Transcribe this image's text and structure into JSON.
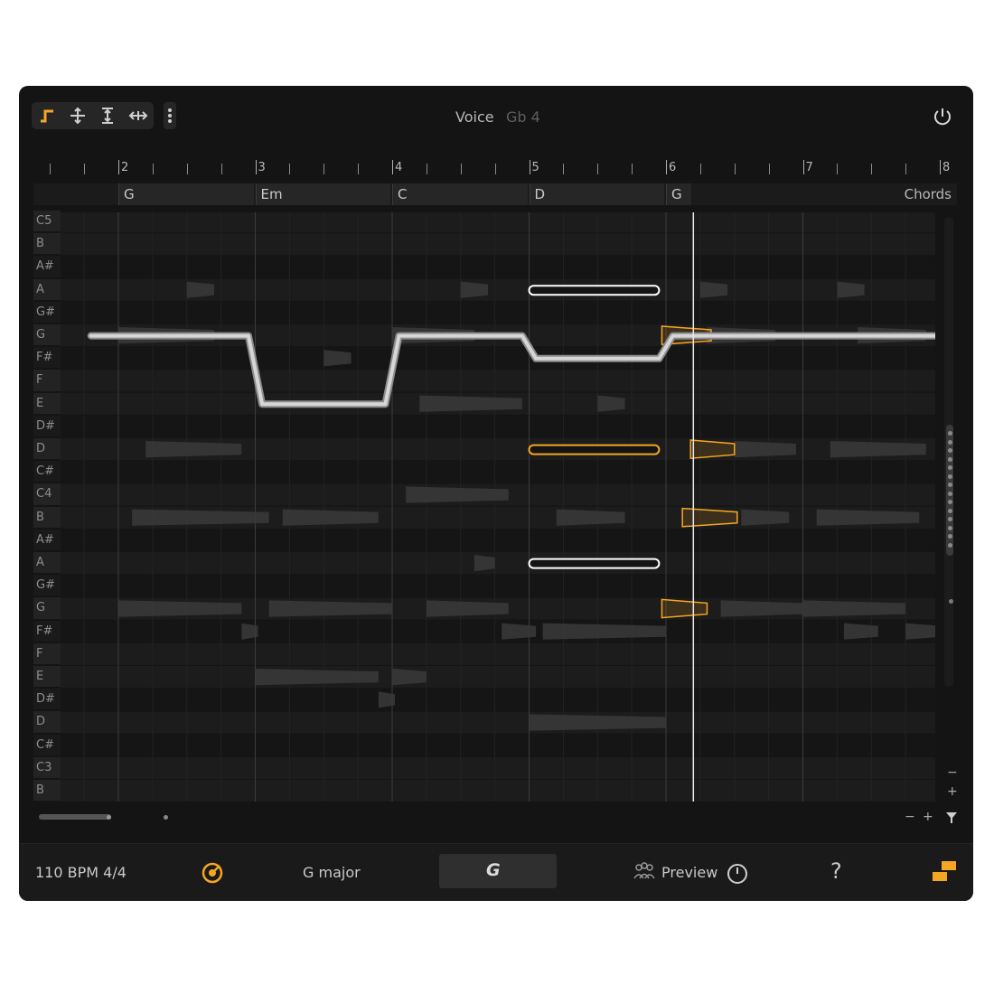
{
  "app": {
    "title_voice": "Voice",
    "title_pitch": "Gb 4"
  },
  "toolbar": {
    "tools": [
      {
        "name": "note-tool-icon",
        "active": true
      },
      {
        "name": "move-tool-icon",
        "active": false
      },
      {
        "name": "stretch-tool-icon",
        "active": false
      },
      {
        "name": "time-tool-icon",
        "active": false
      }
    ],
    "more_icon": "more-vertical-icon",
    "power_icon": "power-icon"
  },
  "ruler": {
    "bars": [
      "2",
      "3",
      "4",
      "5",
      "6",
      "7",
      "8"
    ]
  },
  "chords": {
    "items": [
      {
        "name": "G",
        "start": 2,
        "end": 3
      },
      {
        "name": "Em",
        "start": 3,
        "end": 4
      },
      {
        "name": "C",
        "start": 4,
        "end": 5
      },
      {
        "name": "D",
        "start": 5,
        "end": 6
      },
      {
        "name": "G",
        "start": 6,
        "end": 6.2
      }
    ],
    "label": "Chords"
  },
  "keys": [
    "C5",
    "B",
    "A#",
    "A",
    "G#",
    "G",
    "F#",
    "F",
    "E",
    "D#",
    "D",
    "C#",
    "C4",
    "B",
    "A#",
    "A",
    "G#",
    "G",
    "F#",
    "F",
    "E",
    "D#",
    "D",
    "C#",
    "C3",
    "B"
  ],
  "playhead_beat": 6.2,
  "accent_color": "#f5a623",
  "highlight_color": "#ffffff",
  "melody_path": [
    [
      1.8,
      "G"
    ],
    [
      2.95,
      "G"
    ],
    [
      3.05,
      "E"
    ],
    [
      3.95,
      "E"
    ],
    [
      4.05,
      "G"
    ],
    [
      4.95,
      "G"
    ],
    [
      5.05,
      "F#"
    ],
    [
      5.95,
      "F#"
    ],
    [
      6.05,
      "G"
    ],
    [
      8.0,
      "G"
    ],
    [
      8.05,
      "A"
    ]
  ],
  "selected_notes": [
    {
      "row": 3,
      "start": 5.0,
      "end": 5.95,
      "color": "white"
    },
    {
      "row": 10,
      "start": 5.0,
      "end": 5.95,
      "color": "accent"
    },
    {
      "row": 15,
      "start": 5.0,
      "end": 5.95,
      "color": "white"
    }
  ],
  "accent_outline_notes": [
    {
      "row": 5,
      "start": 5.97,
      "end": 6.33
    },
    {
      "row": 10,
      "start": 6.18,
      "end": 6.5
    },
    {
      "row": 13,
      "start": 6.12,
      "end": 6.52
    },
    {
      "row": 17,
      "start": 5.97,
      "end": 6.3
    }
  ],
  "footer": {
    "tempo": "110 BPM  4/4",
    "metronome_icon": "metronome-icon",
    "key": "G major",
    "snap_label": "G",
    "ensemble_icon": "ensemble-icon",
    "preview_label": "Preview",
    "timer_icon": "timer-icon",
    "help_label": "?",
    "logo_icon": "logo-icon"
  },
  "zoom": {
    "minus": "−",
    "plus": "+"
  }
}
